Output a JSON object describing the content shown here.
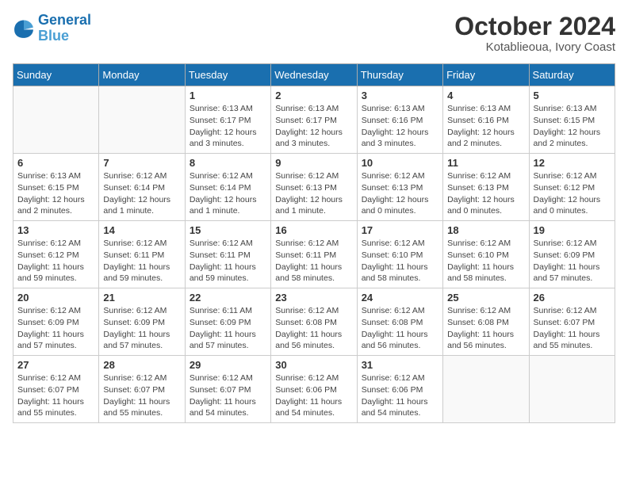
{
  "header": {
    "logo_line1": "General",
    "logo_line2": "Blue",
    "month": "October 2024",
    "location": "Kotablieoua, Ivory Coast"
  },
  "weekdays": [
    "Sunday",
    "Monday",
    "Tuesday",
    "Wednesday",
    "Thursday",
    "Friday",
    "Saturday"
  ],
  "weeks": [
    [
      {
        "day": "",
        "info": ""
      },
      {
        "day": "",
        "info": ""
      },
      {
        "day": "1",
        "info": "Sunrise: 6:13 AM\nSunset: 6:17 PM\nDaylight: 12 hours and 3 minutes."
      },
      {
        "day": "2",
        "info": "Sunrise: 6:13 AM\nSunset: 6:17 PM\nDaylight: 12 hours and 3 minutes."
      },
      {
        "day": "3",
        "info": "Sunrise: 6:13 AM\nSunset: 6:16 PM\nDaylight: 12 hours and 3 minutes."
      },
      {
        "day": "4",
        "info": "Sunrise: 6:13 AM\nSunset: 6:16 PM\nDaylight: 12 hours and 2 minutes."
      },
      {
        "day": "5",
        "info": "Sunrise: 6:13 AM\nSunset: 6:15 PM\nDaylight: 12 hours and 2 minutes."
      }
    ],
    [
      {
        "day": "6",
        "info": "Sunrise: 6:13 AM\nSunset: 6:15 PM\nDaylight: 12 hours and 2 minutes."
      },
      {
        "day": "7",
        "info": "Sunrise: 6:12 AM\nSunset: 6:14 PM\nDaylight: 12 hours and 1 minute."
      },
      {
        "day": "8",
        "info": "Sunrise: 6:12 AM\nSunset: 6:14 PM\nDaylight: 12 hours and 1 minute."
      },
      {
        "day": "9",
        "info": "Sunrise: 6:12 AM\nSunset: 6:13 PM\nDaylight: 12 hours and 1 minute."
      },
      {
        "day": "10",
        "info": "Sunrise: 6:12 AM\nSunset: 6:13 PM\nDaylight: 12 hours and 0 minutes."
      },
      {
        "day": "11",
        "info": "Sunrise: 6:12 AM\nSunset: 6:13 PM\nDaylight: 12 hours and 0 minutes."
      },
      {
        "day": "12",
        "info": "Sunrise: 6:12 AM\nSunset: 6:12 PM\nDaylight: 12 hours and 0 minutes."
      }
    ],
    [
      {
        "day": "13",
        "info": "Sunrise: 6:12 AM\nSunset: 6:12 PM\nDaylight: 11 hours and 59 minutes."
      },
      {
        "day": "14",
        "info": "Sunrise: 6:12 AM\nSunset: 6:11 PM\nDaylight: 11 hours and 59 minutes."
      },
      {
        "day": "15",
        "info": "Sunrise: 6:12 AM\nSunset: 6:11 PM\nDaylight: 11 hours and 59 minutes."
      },
      {
        "day": "16",
        "info": "Sunrise: 6:12 AM\nSunset: 6:11 PM\nDaylight: 11 hours and 58 minutes."
      },
      {
        "day": "17",
        "info": "Sunrise: 6:12 AM\nSunset: 6:10 PM\nDaylight: 11 hours and 58 minutes."
      },
      {
        "day": "18",
        "info": "Sunrise: 6:12 AM\nSunset: 6:10 PM\nDaylight: 11 hours and 58 minutes."
      },
      {
        "day": "19",
        "info": "Sunrise: 6:12 AM\nSunset: 6:09 PM\nDaylight: 11 hours and 57 minutes."
      }
    ],
    [
      {
        "day": "20",
        "info": "Sunrise: 6:12 AM\nSunset: 6:09 PM\nDaylight: 11 hours and 57 minutes."
      },
      {
        "day": "21",
        "info": "Sunrise: 6:12 AM\nSunset: 6:09 PM\nDaylight: 11 hours and 57 minutes."
      },
      {
        "day": "22",
        "info": "Sunrise: 6:11 AM\nSunset: 6:09 PM\nDaylight: 11 hours and 57 minutes."
      },
      {
        "day": "23",
        "info": "Sunrise: 6:12 AM\nSunset: 6:08 PM\nDaylight: 11 hours and 56 minutes."
      },
      {
        "day": "24",
        "info": "Sunrise: 6:12 AM\nSunset: 6:08 PM\nDaylight: 11 hours and 56 minutes."
      },
      {
        "day": "25",
        "info": "Sunrise: 6:12 AM\nSunset: 6:08 PM\nDaylight: 11 hours and 56 minutes."
      },
      {
        "day": "26",
        "info": "Sunrise: 6:12 AM\nSunset: 6:07 PM\nDaylight: 11 hours and 55 minutes."
      }
    ],
    [
      {
        "day": "27",
        "info": "Sunrise: 6:12 AM\nSunset: 6:07 PM\nDaylight: 11 hours and 55 minutes."
      },
      {
        "day": "28",
        "info": "Sunrise: 6:12 AM\nSunset: 6:07 PM\nDaylight: 11 hours and 55 minutes."
      },
      {
        "day": "29",
        "info": "Sunrise: 6:12 AM\nSunset: 6:07 PM\nDaylight: 11 hours and 54 minutes."
      },
      {
        "day": "30",
        "info": "Sunrise: 6:12 AM\nSunset: 6:06 PM\nDaylight: 11 hours and 54 minutes."
      },
      {
        "day": "31",
        "info": "Sunrise: 6:12 AM\nSunset: 6:06 PM\nDaylight: 11 hours and 54 minutes."
      },
      {
        "day": "",
        "info": ""
      },
      {
        "day": "",
        "info": ""
      }
    ]
  ]
}
